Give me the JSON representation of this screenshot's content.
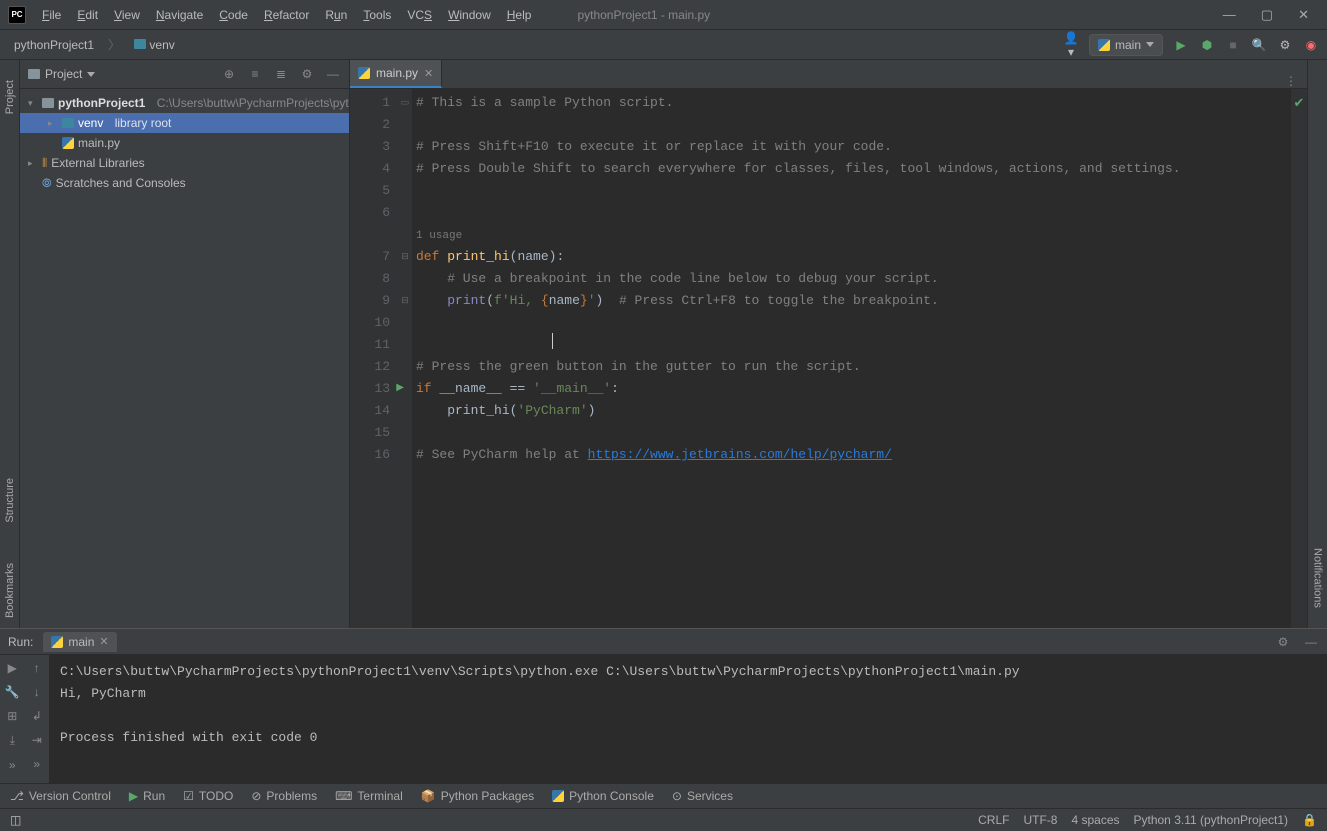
{
  "window": {
    "title": "pythonProject1 - main.py"
  },
  "menus": [
    "File",
    "Edit",
    "View",
    "Navigate",
    "Code",
    "Refactor",
    "Run",
    "Tools",
    "VCS",
    "Window",
    "Help"
  ],
  "breadcrumb": {
    "root": "pythonProject1",
    "item": "venv"
  },
  "interpreter": {
    "label": "main"
  },
  "project": {
    "label": "Project",
    "root": {
      "name": "pythonProject1",
      "path": "C:\\Users\\buttw\\PycharmProjects\\pyt"
    },
    "venv": {
      "name": "venv",
      "tag": "library root"
    },
    "file": "main.py",
    "ext": "External Libraries",
    "scratch": "Scratches and Consoles"
  },
  "tab": {
    "name": "main.py"
  },
  "code": {
    "l1": "# This is a sample Python script.",
    "l3": "# Press Shift+F10 to execute it or replace it with your code.",
    "l4": "# Press Double Shift to search everywhere for classes, files, tool windows, actions, and settings.",
    "hint": "1 usage",
    "l7a": "def ",
    "l7b": "print_hi",
    "l7c": "(",
    "l7d": "name",
    "l7e": "):",
    "l8": "    # Use a breakpoint in the code line below to debug your script.",
    "l9a": "    ",
    "l9b": "print",
    "l9c": "(",
    "l9d": "f'",
    "l9e": "Hi, ",
    "l9f": "{",
    "l9g": "name",
    "l9h": "}",
    "l9i": "'",
    "l9j": ")  ",
    "l9k": "# Press Ctrl+F8 to toggle the breakpoint.",
    "l12": "# Press the green button in the gutter to run the script.",
    "l13a": "if ",
    "l13b": "__name__",
    "l13c": " == ",
    "l13d": "'__main__'",
    "l13e": ":",
    "l14a": "    print_hi(",
    "l14b": "'PyCharm'",
    "l14c": ")",
    "l16a": "# See PyCharm help at ",
    "l16b": "https://www.jetbrains.com/help/pycharm/"
  },
  "run": {
    "label": "Run:",
    "tab": "main",
    "out1": "C:\\Users\\buttw\\PycharmProjects\\pythonProject1\\venv\\Scripts\\python.exe C:\\Users\\buttw\\PycharmProjects\\pythonProject1\\main.py",
    "out2": "Hi, PyCharm",
    "out3": "Process finished with exit code 0"
  },
  "bottom": {
    "vc": "Version Control",
    "run": "Run",
    "todo": "TODO",
    "prob": "Problems",
    "term": "Terminal",
    "pkg": "Python Packages",
    "pycon": "Python Console",
    "svc": "Services"
  },
  "status": {
    "crlf": "CRLF",
    "enc": "UTF-8",
    "indent": "4 spaces",
    "py": "Python 3.11 (pythonProject1)"
  },
  "side": {
    "project": "Project",
    "structure": "Structure",
    "bookmarks": "Bookmarks",
    "notif": "Notifications"
  }
}
